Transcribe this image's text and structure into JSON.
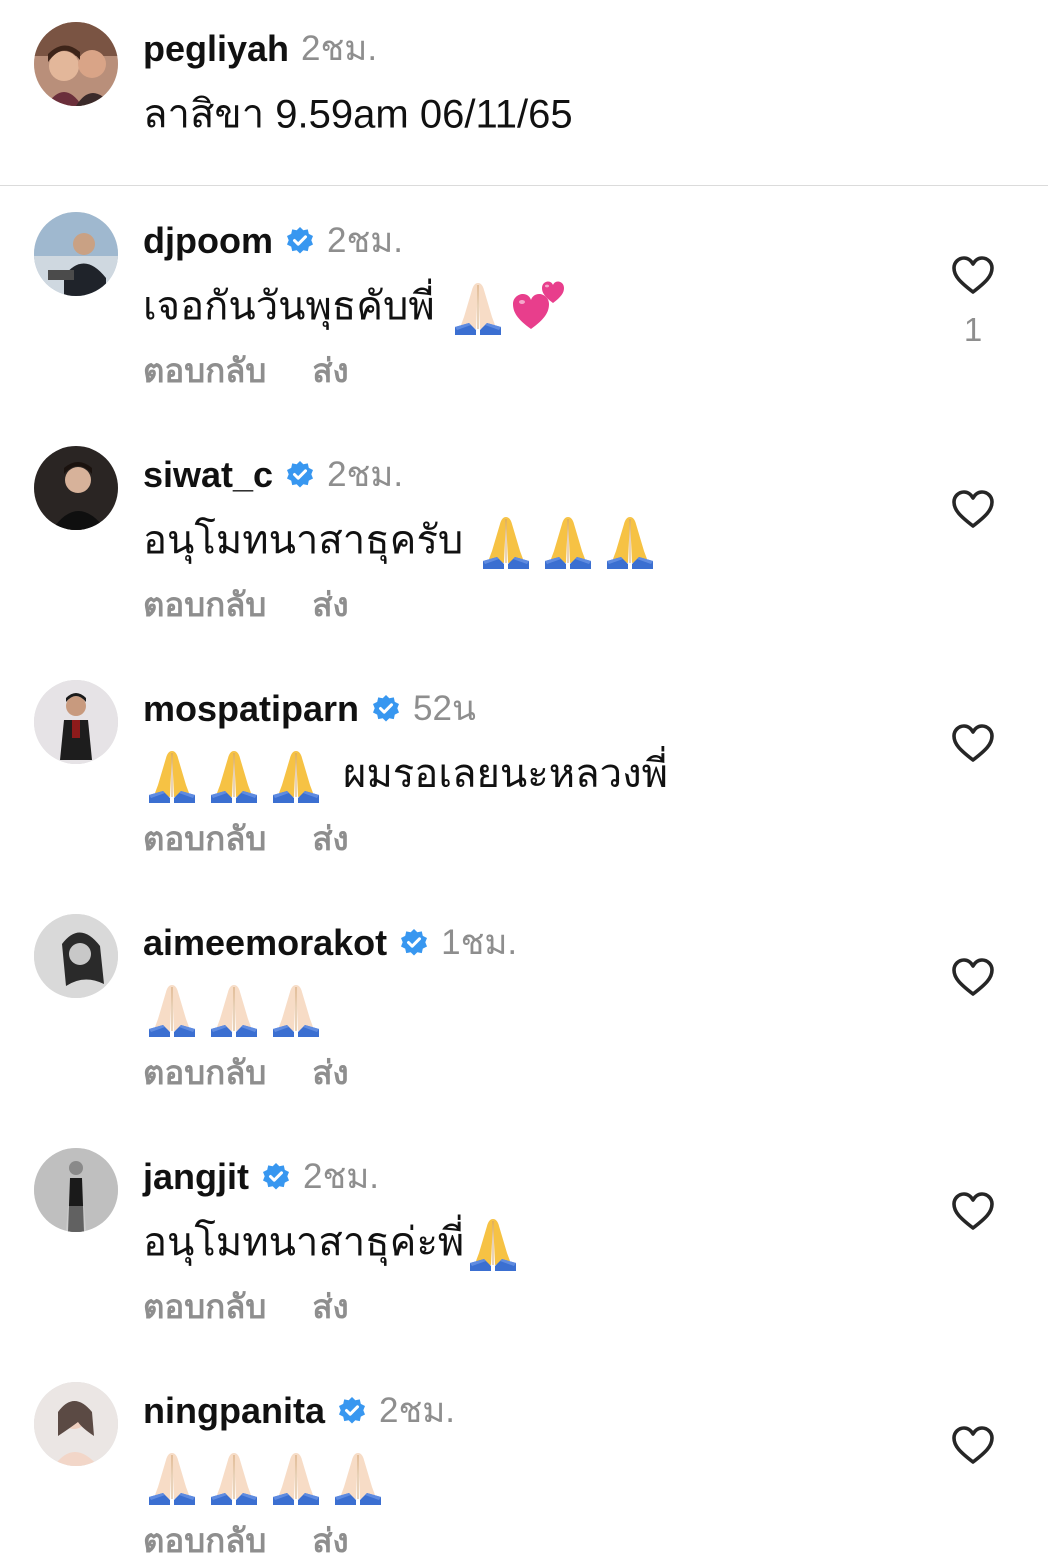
{
  "caption": {
    "username": "pegliyah",
    "time": "2ชม.",
    "text": "ลาสิขา 9.59am 06/11/65"
  },
  "actions": {
    "reply_label": "ตอบกลับ",
    "send_label": "ส่ง"
  },
  "comments": [
    {
      "username": "djpoom",
      "verified": true,
      "time": "2ชม.",
      "text": "เจอกันวันพุธคับพี่",
      "emojis_after": [
        "folded-hands-light",
        "two-hearts"
      ],
      "likes": "1"
    },
    {
      "username": "siwat_c",
      "verified": true,
      "time": "2ชม.",
      "text": "อนุโมทนาสาธุครับ",
      "emojis_after": [
        "folded-hands",
        "folded-hands",
        "folded-hands"
      ]
    },
    {
      "username": "mospatiparn",
      "verified": true,
      "time": "52น",
      "text": "ผมรอเลยนะหลวงพี่",
      "emojis_before": [
        "folded-hands",
        "folded-hands",
        "folded-hands"
      ]
    },
    {
      "username": "aimeemorakot",
      "verified": true,
      "time": "1ชม.",
      "text": "",
      "emojis_after": [
        "folded-hands-light",
        "folded-hands-light",
        "folded-hands-light"
      ]
    },
    {
      "username": "jangjit",
      "verified": true,
      "time": "2ชม.",
      "text": "อนุโมทนาสาธุค่ะพี่",
      "emojis_after": [
        "folded-hands"
      ]
    },
    {
      "username": "ningpanita",
      "verified": true,
      "time": "2ชม.",
      "text": "",
      "emojis_after": [
        "folded-hands-light",
        "folded-hands-light",
        "folded-hands-light",
        "folded-hands-light"
      ]
    }
  ],
  "colors": {
    "verified_badge": "#3897f0",
    "secondary_text": "#8e8e8e",
    "divider": "#dbdbdb",
    "folded_hands_default": "#f6c244",
    "folded_hands_light": "#f7dcc6",
    "heart_emoji": "#e83e8c"
  },
  "icons": {
    "like": "heart-outline-icon",
    "verified": "verified-badge-icon"
  }
}
